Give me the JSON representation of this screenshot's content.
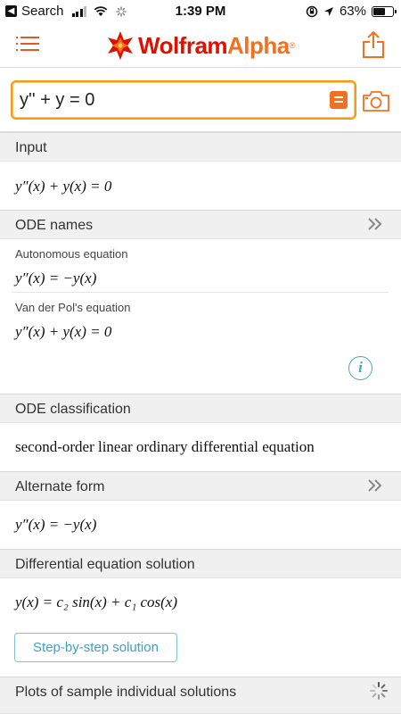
{
  "status_bar": {
    "back_label": "Search",
    "time": "1:39 PM",
    "battery": "63%",
    "battery_level": 0.63
  },
  "header": {
    "logo_part1": "Wolfram",
    "logo_part2": "Alpha"
  },
  "search": {
    "value": "y'' + y = 0"
  },
  "pods": {
    "input": {
      "title": "Input",
      "result": "y″(x) + y(x) = 0"
    },
    "ode_names": {
      "title": "ODE names",
      "items": [
        {
          "label": "Autonomous equation",
          "result": "y″(x) = −y(x)"
        },
        {
          "label": "Van der Pol's equation",
          "result": "y″(x) + y(x) = 0"
        }
      ]
    },
    "ode_classification": {
      "title": "ODE classification",
      "result": "second-order linear ordinary differential equation"
    },
    "alternate_form": {
      "title": "Alternate form",
      "result": "y″(x) = −y(x)"
    },
    "solution": {
      "title": "Differential equation solution",
      "result": "y(x) = c₂ sin(x) + c₁ cos(x)",
      "step_button": "Step-by-step solution"
    },
    "plots": {
      "title": "Plots of sample individual solutions"
    }
  },
  "colors": {
    "accent": "#f37021",
    "logo_red": "#dd1100",
    "link": "#3f9fc4",
    "pod_header_bg": "#f0f0f0"
  },
  "icons": [
    "back-icon",
    "signal-icon",
    "wifi-icon",
    "loading-icon",
    "location-icon",
    "lock-rotation-icon",
    "battery-icon",
    "menu-icon",
    "wolfram-star-icon",
    "share-icon",
    "equals-icon",
    "camera-icon",
    "chevron-double-right-icon",
    "info-icon",
    "spinner-icon"
  ]
}
